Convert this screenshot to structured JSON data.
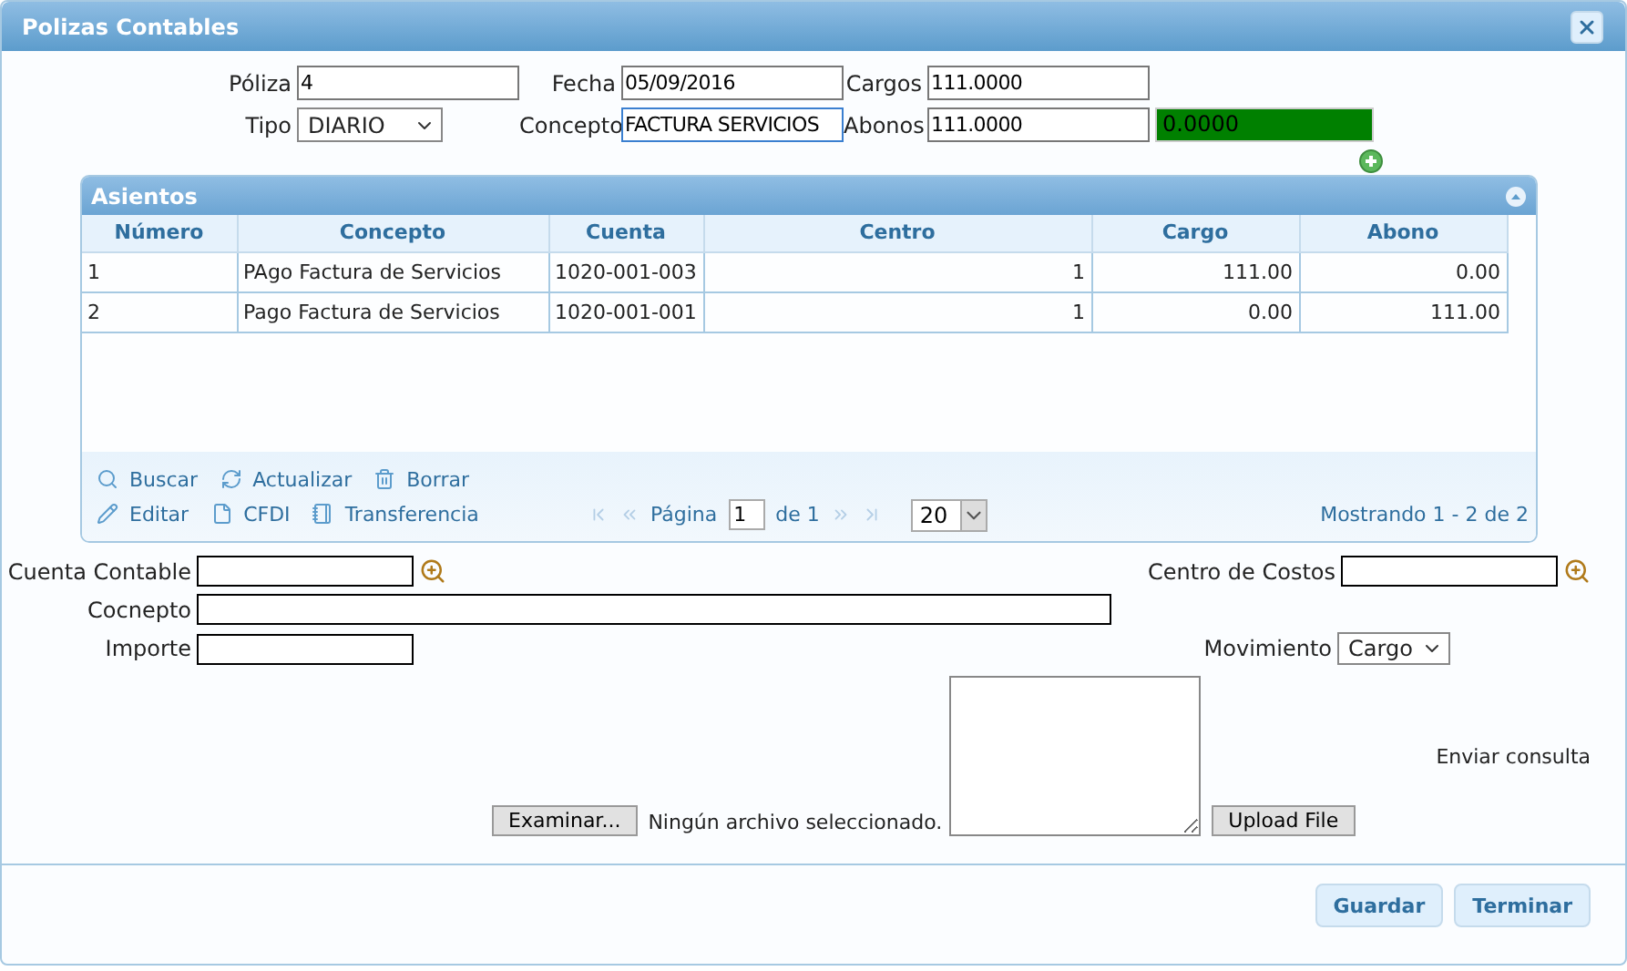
{
  "window": {
    "title": "Polizas Contables"
  },
  "header": {
    "rows": [
      [
        {
          "label": "Póliza",
          "value": "4",
          "kind": "input"
        },
        {
          "label": "Fecha",
          "value": "05/09/2016",
          "kind": "input"
        },
        {
          "label": "Cargos",
          "value": "111.0000",
          "kind": "input"
        }
      ],
      [
        {
          "label": "Tipo",
          "value": "DIARIO",
          "kind": "select"
        },
        {
          "label": "Concepto",
          "value": "FACTURA SERVICIOS",
          "kind": "input",
          "focused": true
        },
        {
          "label": "Abonos",
          "value": "111.0000",
          "kind": "input"
        },
        {
          "value": "0.0000",
          "kind": "readout",
          "color": "#008000"
        }
      ]
    ]
  },
  "panel": {
    "title": "Asientos",
    "expanded": true,
    "table": {
      "columns": [
        {
          "label": "Número"
        },
        {
          "label": "Concepto"
        },
        {
          "label": "Cuenta"
        },
        {
          "label": "Centro"
        },
        {
          "label": "Cargo"
        },
        {
          "label": "Abono"
        }
      ],
      "rows": [
        [
          "1",
          "PAgo Factura de Servicios",
          "1020-001-003",
          "1",
          "111.00",
          "0.00"
        ],
        [
          "2",
          "Pago Factura de Servicios",
          "1020-001-001",
          "1",
          "0.00",
          "111.00"
        ]
      ]
    },
    "actions": [
      [
        {
          "label": "Buscar",
          "kind": "search"
        },
        {
          "label": "Actualizar",
          "kind": "refresh"
        },
        {
          "label": "Borrar",
          "kind": "delete"
        }
      ],
      [
        {
          "label": "Editar",
          "kind": "edit"
        },
        {
          "label": "CFDI",
          "kind": "file"
        },
        {
          "label": "Transferencia",
          "kind": "transfer"
        }
      ]
    ],
    "pager": {
      "page_label": "Página",
      "page": "1",
      "of": "de 1",
      "page_size": "20",
      "summary": "Mostrando 1 - 2 de 2"
    }
  },
  "detail": {
    "cuenta_label": "Cuenta Contable",
    "centro_label": "Centro de Costos",
    "concepto_label": "Cocnepto",
    "importe_label": "Importe",
    "movimiento_label": "Movimiento",
    "movimiento": "Cargo"
  },
  "upload": {
    "browse": "Examinar...",
    "file_status": "Ningún archivo seleccionado.",
    "upload": "Upload File",
    "send": "Enviar consulta"
  },
  "buttons": [
    "Guardar",
    "Terminar"
  ]
}
